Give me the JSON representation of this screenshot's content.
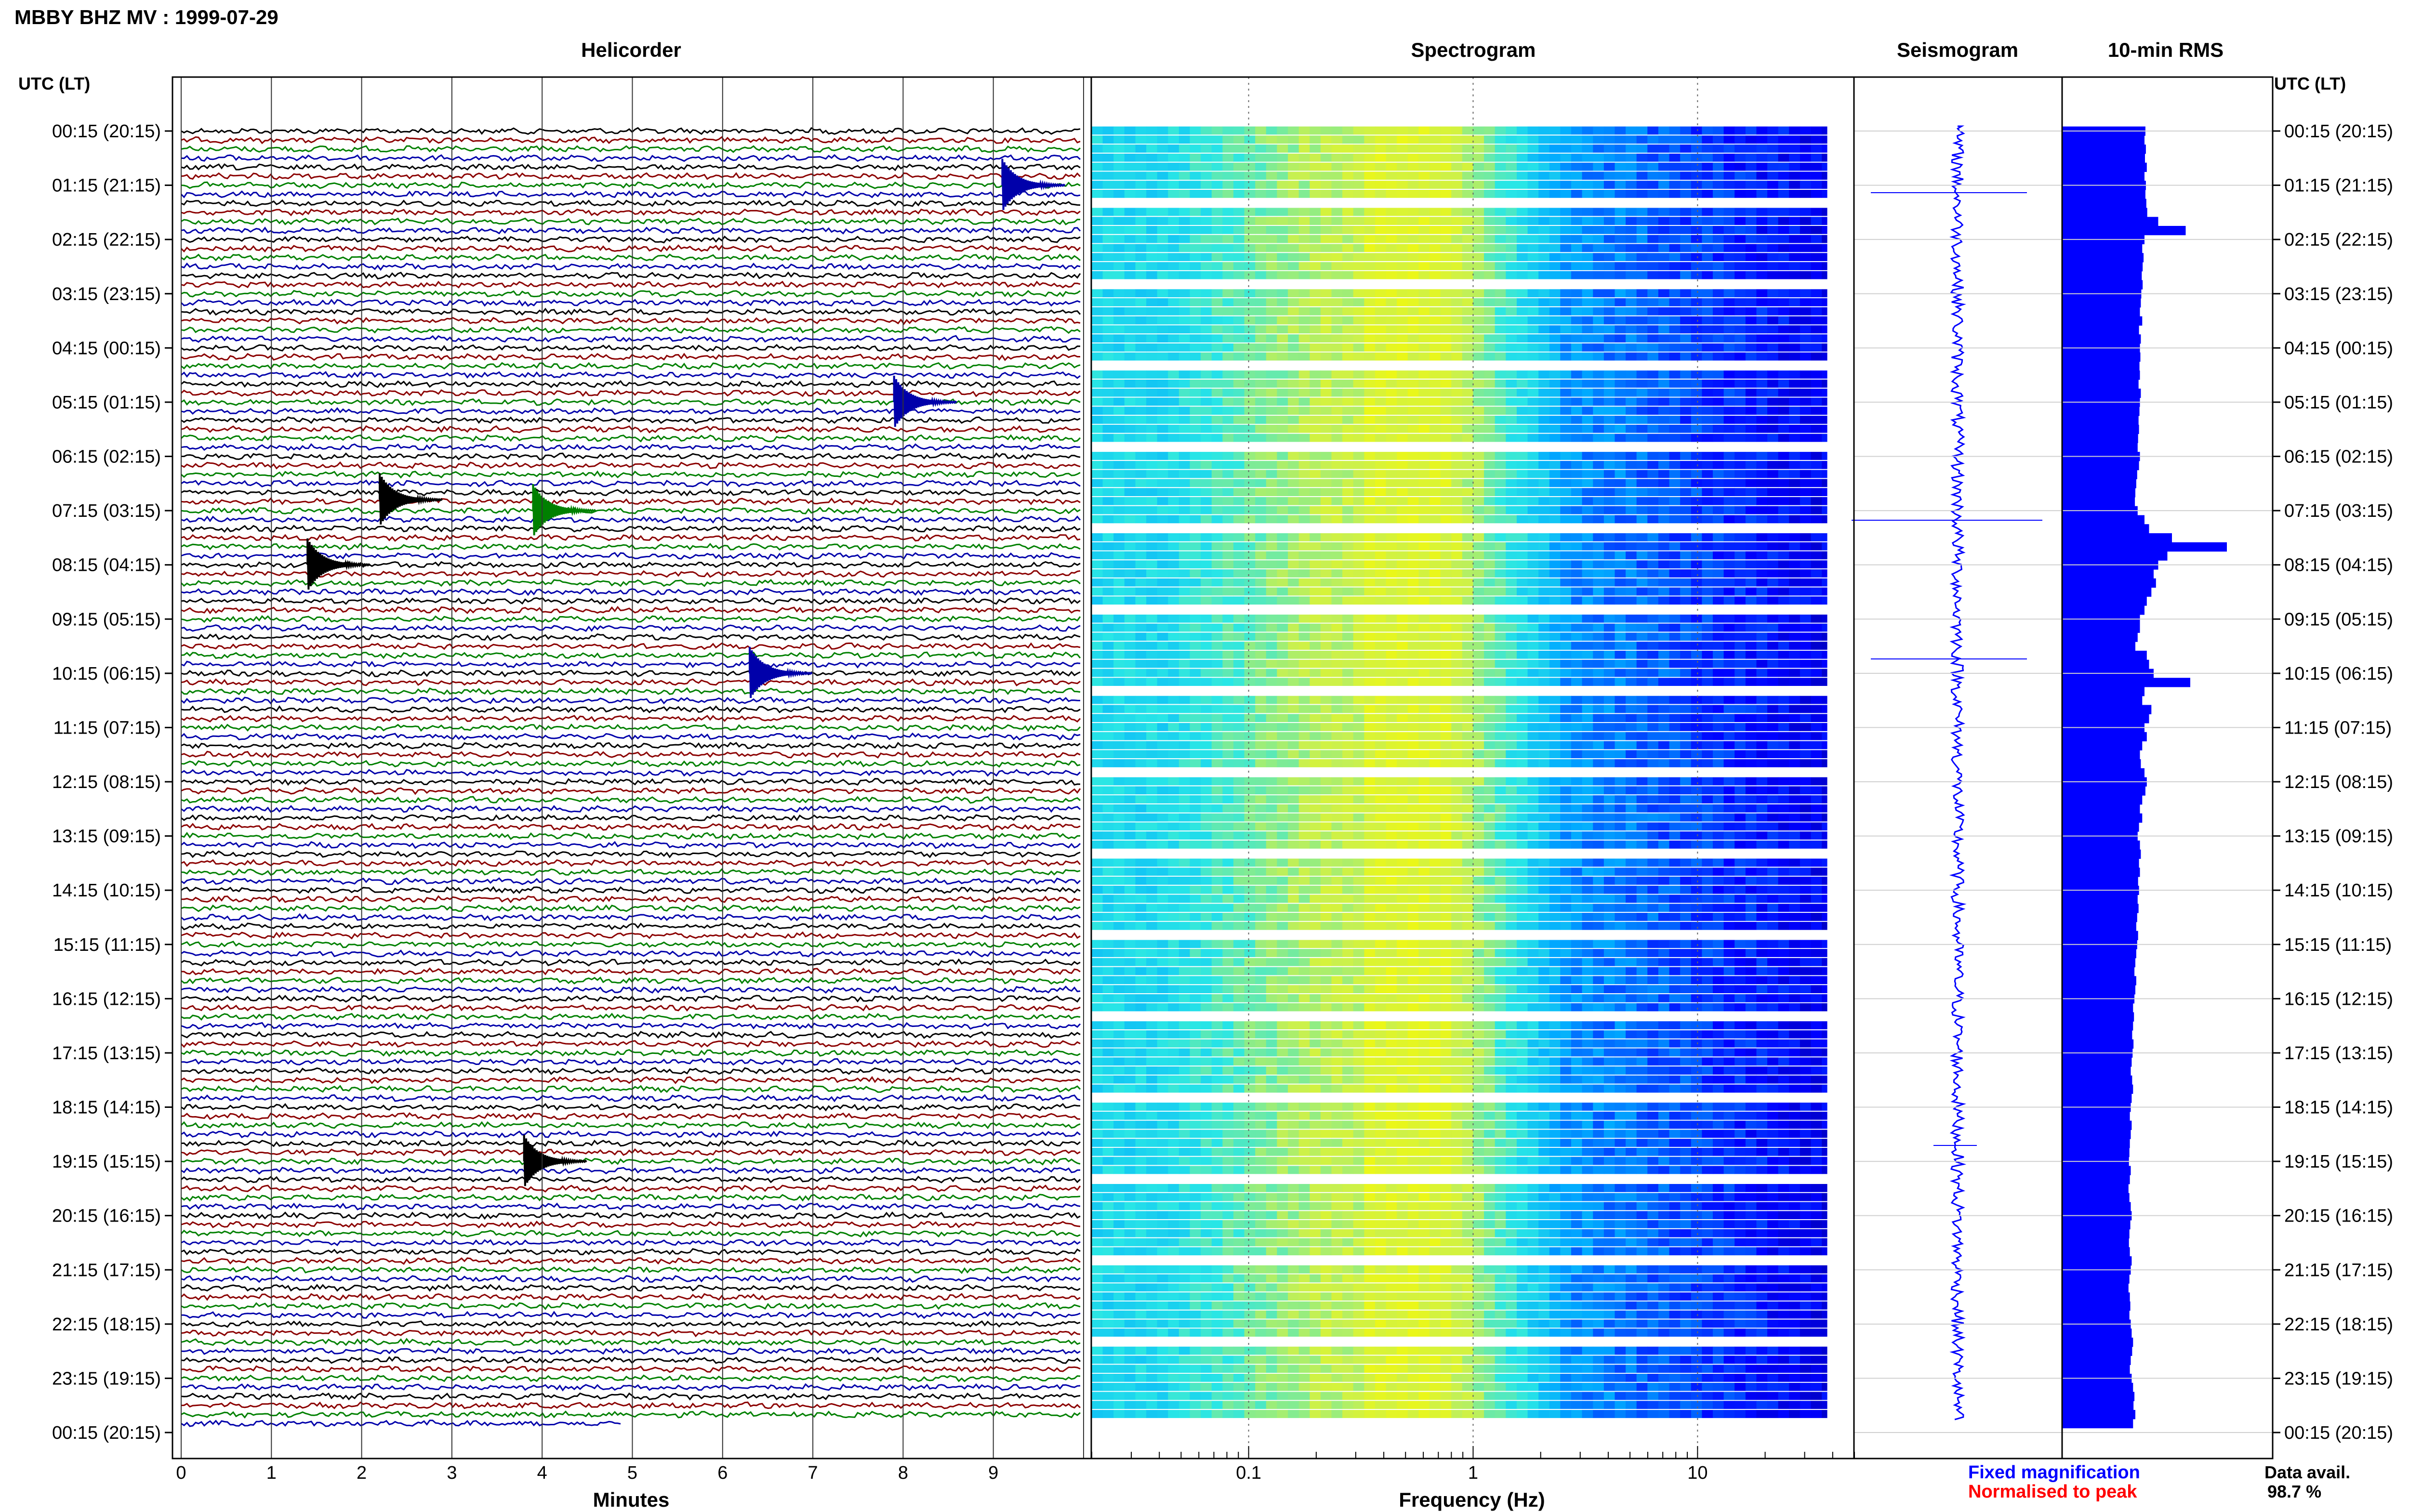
{
  "header": {
    "title": "MBBY BHZ MV : 1999-07-29"
  },
  "panels": {
    "helicorder": "Helicorder",
    "spectrogram": "Spectrogram",
    "seismogram": "Seismogram",
    "rms": "10-min RMS"
  },
  "axes": {
    "left_label": "UTC (LT)",
    "right_label": "UTC (LT)",
    "time_ticks": [
      "00:15 (20:15)",
      "01:15 (21:15)",
      "02:15 (22:15)",
      "03:15 (23:15)",
      "04:15 (00:15)",
      "05:15 (01:15)",
      "06:15 (02:15)",
      "07:15 (03:15)",
      "08:15 (04:15)",
      "09:15 (05:15)",
      "10:15 (06:15)",
      "11:15 (07:15)",
      "12:15 (08:15)",
      "13:15 (09:15)",
      "14:15 (10:15)",
      "15:15 (11:15)",
      "16:15 (12:15)",
      "17:15 (13:15)",
      "18:15 (14:15)",
      "19:15 (15:15)",
      "20:15 (16:15)",
      "21:15 (17:15)",
      "22:15 (18:15)",
      "23:15 (19:15)",
      "00:15 (20:15)"
    ],
    "minutes_label": "Minutes",
    "minute_ticks": [
      "0",
      "1",
      "2",
      "3",
      "4",
      "5",
      "6",
      "7",
      "8",
      "9"
    ],
    "frequency_label": "Frequency (Hz)",
    "frequency_ticks": [
      "0.1",
      "1",
      "10"
    ]
  },
  "legend": {
    "fixed": "Fixed magnification",
    "normalised": "Normalised to peak",
    "avail_label": "Data avail.",
    "avail_value": "98.7 %"
  },
  "colors": {
    "fixed": "#0000ff",
    "normalised": "#ff0000",
    "trace_cycle": [
      "#000000",
      "#8b0000",
      "#008000",
      "#0000aa"
    ]
  },
  "chart_data": [
    {
      "type": "line",
      "panel": "Helicorder",
      "xlabel": "Minutes",
      "xlim": [
        0,
        10
      ],
      "rows_per_hour": 6,
      "note_events": [
        {
          "hour": 1.0,
          "minute": 9.1,
          "color": "#0000aa"
        },
        {
          "hour": 5.0,
          "minute": 7.9,
          "color": "#0000aa"
        },
        {
          "hour": 6.8,
          "minute": 2.2,
          "color": "#000000"
        },
        {
          "hour": 7.0,
          "minute": 3.9,
          "color": "#008000"
        },
        {
          "hour": 8.0,
          "minute": 1.4,
          "color": "#000000"
        },
        {
          "hour": 10.0,
          "minute": 6.3,
          "color": "#0000aa"
        },
        {
          "hour": 19.0,
          "minute": 3.8,
          "color": "#000000"
        }
      ]
    },
    {
      "type": "heatmap",
      "panel": "Spectrogram",
      "xlabel": "Frequency (Hz)",
      "xscale": "log",
      "xlim": [
        0.02,
        50
      ],
      "ylim_hours": [
        0,
        24
      ]
    },
    {
      "type": "bar",
      "panel": "10-min RMS",
      "orientation": "horizontal",
      "rows_per_hour": 6,
      "values": [
        1.82,
        1.8,
        1.83,
        1.81,
        1.85,
        1.8,
        1.83,
        1.82,
        1.84,
        1.86,
        2.1,
        2.7,
        1.8,
        1.75,
        1.78,
        1.76,
        1.74,
        1.76,
        1.73,
        1.72,
        1.7,
        1.75,
        1.68,
        1.72,
        1.7,
        1.71,
        1.69,
        1.7,
        1.67,
        1.72,
        1.7,
        1.69,
        1.67,
        1.68,
        1.66,
        1.65,
        1.7,
        1.68,
        1.64,
        1.62,
        1.6,
        1.59,
        1.65,
        1.8,
        1.9,
        2.4,
        3.6,
        2.3,
        2.1,
        2.0,
        2.05,
        1.95,
        1.85,
        1.8,
        1.7,
        1.7,
        1.65,
        1.6,
        1.85,
        1.9,
        2.0,
        2.8,
        1.8,
        1.75,
        1.95,
        1.9,
        1.8,
        1.85,
        1.75,
        1.7,
        1.72,
        1.8,
        1.85,
        1.82,
        1.75,
        1.7,
        1.75,
        1.68,
        1.65,
        1.7,
        1.72,
        1.68,
        1.7,
        1.66,
        1.68,
        1.65,
        1.67,
        1.64,
        1.62,
        1.66,
        1.64,
        1.62,
        1.6,
        1.58,
        1.62,
        1.6,
        1.58,
        1.55,
        1.57,
        1.55,
        1.53,
        1.56,
        1.54,
        1.52,
        1.5,
        1.53,
        1.55,
        1.52,
        1.5,
        1.48,
        1.52,
        1.5,
        1.48,
        1.47,
        1.46,
        1.5,
        1.48,
        1.45,
        1.47,
        1.5,
        1.52,
        1.49,
        1.47,
        1.46,
        1.48,
        1.52,
        1.5,
        1.47,
        1.45,
        1.48,
        1.49,
        1.47,
        1.5,
        1.52,
        1.55,
        1.53,
        1.5,
        1.48,
        1.52,
        1.55,
        1.58,
        1.56,
        1.6,
        1.55
      ],
      "xlabel": "",
      "ylabel": ""
    }
  ]
}
